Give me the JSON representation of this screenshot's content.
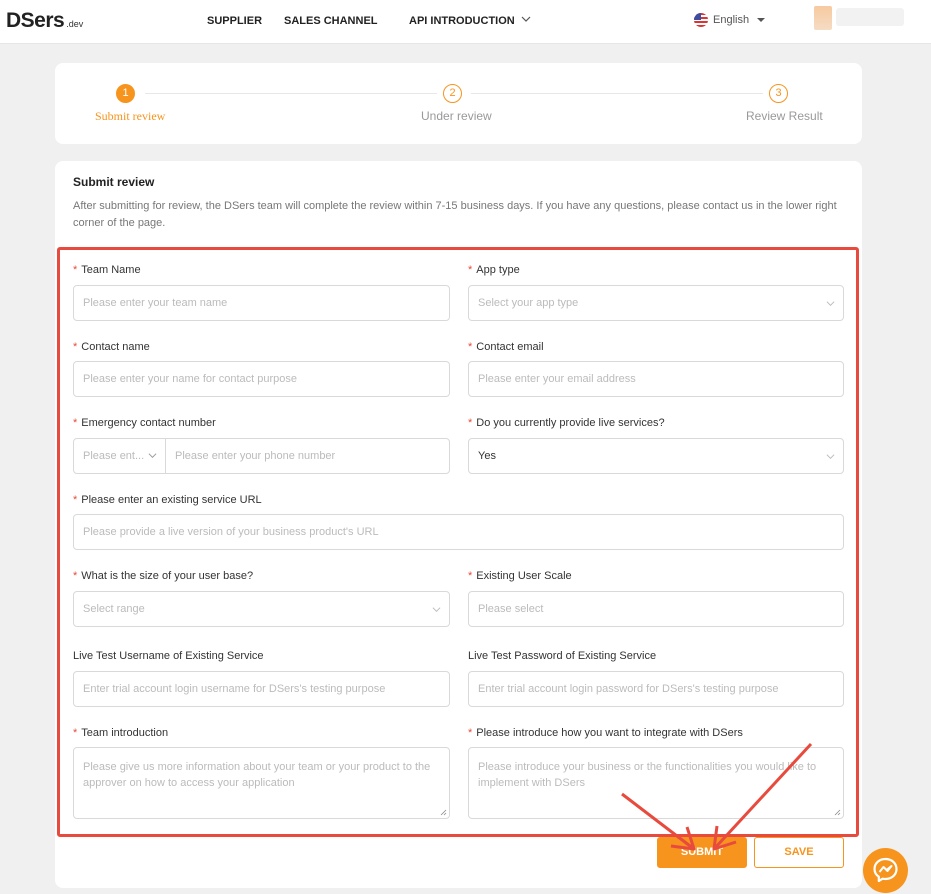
{
  "header": {
    "logo": "DSers",
    "logo_suffix": ".dev",
    "nav": [
      "SUPPLIER",
      "SALES CHANNEL",
      "API INTRODUCTION"
    ],
    "language": "English"
  },
  "steps": [
    {
      "number": "1",
      "label": "Submit review",
      "state": "active"
    },
    {
      "number": "2",
      "label": "Under review",
      "state": "todo"
    },
    {
      "number": "3",
      "label": "Review Result",
      "state": "todo"
    }
  ],
  "form": {
    "title": "Submit review",
    "description": "After submitting for review, the DSers team will complete the review within 7-15 business days. If you have any questions, please contact us in the lower right corner of the page.",
    "required_mark": "*",
    "team_name": {
      "label": "Team Name",
      "placeholder": "Please enter your team name"
    },
    "app_type": {
      "label": "App type",
      "placeholder": "Select your app type"
    },
    "contact_name": {
      "label": "Contact name",
      "placeholder": "Please enter your name for contact purpose"
    },
    "contact_email": {
      "label": "Contact email",
      "placeholder": "Please enter your email address"
    },
    "emergency_number": {
      "label": "Emergency contact number",
      "code_placeholder": "Please ent...",
      "placeholder": "Please enter your phone number"
    },
    "live_services": {
      "label": "Do you currently provide live services?",
      "value": "Yes"
    },
    "service_url": {
      "label": "Please enter an existing service URL",
      "placeholder": "Please provide a live version of your business product's URL"
    },
    "user_base": {
      "label": "What is the size of your user base?",
      "placeholder": "Select range"
    },
    "user_scale": {
      "label": "Existing User Scale",
      "placeholder": "Please select"
    },
    "test_username": {
      "label": "Live Test Username of Existing Service",
      "placeholder": "Enter trial account login username for DSers's testing purpose"
    },
    "test_password": {
      "label": "Live Test Password of Existing Service",
      "placeholder": "Enter trial account login password for DSers's testing purpose"
    },
    "team_intro": {
      "label": "Team introduction",
      "placeholder": "Please give us more information about your team or your product to the approver on how to access your application"
    },
    "integration": {
      "label": "Please introduce how you want to integrate with DSers",
      "placeholder": "Please introduce your business or the functionalities you would like to implement with DSers"
    }
  },
  "buttons": {
    "submit": "SUBMIT",
    "save": "SAVE"
  },
  "colors": {
    "accent": "#f7941d",
    "highlight": "#e84a3d"
  }
}
